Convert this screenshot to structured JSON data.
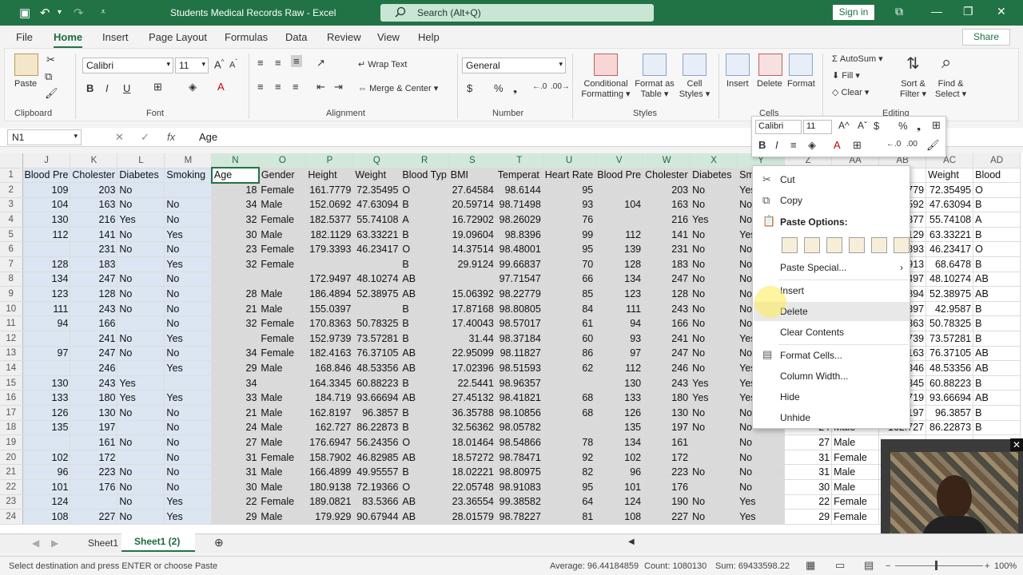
{
  "window": {
    "title": "Students Medical Records Raw  -  Excel",
    "search_placeholder": "Search (Alt+Q)",
    "signin": "Sign in"
  },
  "tabs": [
    "File",
    "Home",
    "Insert",
    "Page Layout",
    "Formulas",
    "Data",
    "Review",
    "View",
    "Help"
  ],
  "share": "Share",
  "ribbon": {
    "clipboard": {
      "label": "Clipboard",
      "paste": "Paste"
    },
    "font": {
      "label": "Font",
      "name": "Calibri",
      "size": "11"
    },
    "alignment": {
      "label": "Alignment",
      "wrap": "Wrap Text",
      "merge": "Merge & Center"
    },
    "number": {
      "label": "Number",
      "format": "General"
    },
    "styles": {
      "label": "Styles",
      "cond": "Conditional",
      "cond2": "Formatting",
      "fmt_table": "Format as",
      "fmt_table2": "Table",
      "cell_styles": "Cell",
      "cell_styles2": "Styles"
    },
    "cells": {
      "label": "Cells",
      "insert": "Insert",
      "delete": "Delete",
      "format": "Format"
    },
    "editing": {
      "label": "Editing",
      "autosum": "AutoSum",
      "fill": "Fill",
      "clear": "Clear",
      "sort": "Sort &",
      "sort2": "Filter",
      "find": "Find &",
      "find2": "Select"
    }
  },
  "formula_bar": {
    "name_box": "N1",
    "content": "Age"
  },
  "columns": [
    "J",
    "K",
    "L",
    "M",
    "N",
    "O",
    "P",
    "Q",
    "R",
    "S",
    "T",
    "U",
    "V",
    "W",
    "X",
    "Y",
    "Z",
    "AA",
    "AB",
    "AC",
    "AD"
  ],
  "rows": [
    [
      "1",
      "Blood Pre",
      "Cholester",
      "Diabetes",
      "Smoking",
      "Age",
      "Gender",
      "Height",
      "Weight",
      "Blood Typ",
      "BMI",
      "Temperat",
      "Heart Rate",
      "Blood Pre",
      "Cholester",
      "Diabetes",
      "Sm",
      "",
      "",
      "",
      "Weight",
      "Blood"
    ],
    [
      "2",
      "109",
      "203",
      "No",
      "",
      "18",
      "Female",
      "161.7779",
      "72.35495",
      "O",
      "27.64584",
      "98.6144",
      "95",
      "",
      "203",
      "No",
      "Yes",
      "",
      "",
      "779",
      "72.35495",
      "O"
    ],
    [
      "3",
      "104",
      "163",
      "No",
      "No",
      "34",
      "Male",
      "152.0692",
      "47.63094",
      "B",
      "20.59714",
      "98.71498",
      "93",
      "104",
      "163",
      "No",
      "No",
      "",
      "",
      "592",
      "47.63094",
      "B"
    ],
    [
      "4",
      "130",
      "216",
      "Yes",
      "No",
      "32",
      "Female",
      "182.5377",
      "55.74108",
      "A",
      "16.72902",
      "98.26029",
      "76",
      "",
      "216",
      "Yes",
      "No",
      "",
      "",
      "377",
      "55.74108",
      "A"
    ],
    [
      "5",
      "112",
      "141",
      "No",
      "Yes",
      "30",
      "Male",
      "182.1129",
      "63.33221",
      "B",
      "19.09604",
      "98.8396",
      "99",
      "112",
      "141",
      "No",
      "Yes",
      "",
      "",
      "129",
      "63.33221",
      "B"
    ],
    [
      "6",
      "",
      "231",
      "No",
      "No",
      "23",
      "Female",
      "179.3393",
      "46.23417",
      "O",
      "14.37514",
      "98.48001",
      "95",
      "139",
      "231",
      "No",
      "No",
      "",
      "",
      "393",
      "46.23417",
      "O"
    ],
    [
      "7",
      "128",
      "183",
      "",
      "Yes",
      "32",
      "Female",
      "",
      "",
      "B",
      "29.9124",
      "99.66837",
      "70",
      "128",
      "183",
      "No",
      "No",
      "",
      "",
      "913",
      "68.6478",
      "B"
    ],
    [
      "8",
      "134",
      "247",
      "No",
      "No",
      "",
      "",
      "172.9497",
      "48.10274",
      "AB",
      "",
      "97.71547",
      "66",
      "134",
      "247",
      "No",
      "No",
      "",
      "",
      "497",
      "48.10274",
      "AB"
    ],
    [
      "9",
      "123",
      "128",
      "No",
      "No",
      "28",
      "Male",
      "186.4894",
      "52.38975",
      "AB",
      "15.06392",
      "98.22779",
      "85",
      "123",
      "128",
      "No",
      "No",
      "",
      "",
      "894",
      "52.38975",
      "AB"
    ],
    [
      "10",
      "111",
      "243",
      "No",
      "No",
      "21",
      "Male",
      "155.0397",
      "",
      "B",
      "17.87168",
      "98.80805",
      "84",
      "111",
      "243",
      "No",
      "No",
      "",
      "",
      "397",
      "42.9587",
      "B"
    ],
    [
      "11",
      "94",
      "166",
      "",
      "No",
      "32",
      "Female",
      "170.8363",
      "50.78325",
      "B",
      "17.40043",
      "98.57017",
      "61",
      "94",
      "166",
      "No",
      "No",
      "",
      "",
      "363",
      "50.78325",
      "B"
    ],
    [
      "12",
      "",
      "241",
      "No",
      "Yes",
      "",
      "Female",
      "152.9739",
      "73.57281",
      "B",
      "31.44",
      "98.37184",
      "60",
      "93",
      "241",
      "No",
      "Yes",
      "",
      "",
      "739",
      "73.57281",
      "B"
    ],
    [
      "13",
      "97",
      "247",
      "No",
      "No",
      "34",
      "Female",
      "182.4163",
      "76.37105",
      "AB",
      "22.95099",
      "98.11827",
      "86",
      "97",
      "247",
      "No",
      "No",
      "",
      "",
      "163",
      "76.37105",
      "AB"
    ],
    [
      "14",
      "",
      "246",
      "",
      "Yes",
      "29",
      "Male",
      "168.846",
      "48.53356",
      "AB",
      "17.02396",
      "98.51593",
      "62",
      "112",
      "246",
      "No",
      "Yes",
      "",
      "",
      "346",
      "48.53356",
      "AB"
    ],
    [
      "15",
      "130",
      "243",
      "Yes",
      "",
      "34",
      "",
      "164.3345",
      "60.88223",
      "B",
      "22.5441",
      "98.96357",
      "",
      "130",
      "243",
      "Yes",
      "Yes",
      "",
      "",
      "345",
      "60.88223",
      "B"
    ],
    [
      "16",
      "133",
      "180",
      "Yes",
      "Yes",
      "33",
      "Male",
      "184.719",
      "93.66694",
      "AB",
      "27.45132",
      "98.41821",
      "68",
      "133",
      "180",
      "Yes",
      "Yes",
      "",
      "",
      "719",
      "93.66694",
      "AB"
    ],
    [
      "17",
      "126",
      "130",
      "No",
      "No",
      "21",
      "Male",
      "162.8197",
      "96.3857",
      "B",
      "36.35788",
      "98.10856",
      "68",
      "126",
      "130",
      "No",
      "No",
      "",
      "",
      "197",
      "96.3857",
      "B"
    ],
    [
      "18",
      "135",
      "197",
      "",
      "No",
      "24",
      "Male",
      "162.727",
      "86.22873",
      "B",
      "32.56362",
      "98.05782",
      "",
      "135",
      "197",
      "No",
      "No",
      "24",
      "Male",
      "162.727",
      "86.22873",
      "B"
    ],
    [
      "19",
      "",
      "161",
      "No",
      "No",
      "27",
      "Male",
      "176.6947",
      "56.24356",
      "O",
      "18.01464",
      "98.54866",
      "78",
      "134",
      "161",
      "",
      "No",
      "27",
      "Male",
      "",
      "",
      ""
    ],
    [
      "20",
      "102",
      "172",
      "",
      "No",
      "31",
      "Female",
      "158.7902",
      "46.82985",
      "AB",
      "18.57272",
      "98.78471",
      "92",
      "102",
      "172",
      "",
      "No",
      "31",
      "Female",
      "",
      "",
      ""
    ],
    [
      "21",
      "96",
      "223",
      "No",
      "No",
      "31",
      "Male",
      "166.4899",
      "49.95557",
      "B",
      "18.02221",
      "98.80975",
      "82",
      "96",
      "223",
      "No",
      "No",
      "31",
      "Male",
      "",
      "",
      ""
    ],
    [
      "22",
      "101",
      "176",
      "No",
      "No",
      "30",
      "Male",
      "180.9138",
      "72.19366",
      "O",
      "22.05748",
      "98.91083",
      "95",
      "101",
      "176",
      "",
      "No",
      "30",
      "Male",
      "",
      "",
      ""
    ],
    [
      "23",
      "124",
      "",
      "No",
      "Yes",
      "22",
      "Female",
      "189.0821",
      "83.5366",
      "AB",
      "23.36554",
      "99.38582",
      "64",
      "124",
      "190",
      "No",
      "Yes",
      "22",
      "Female",
      "",
      "",
      ""
    ],
    [
      "24",
      "108",
      "227",
      "No",
      "Yes",
      "29",
      "Male",
      "179.929",
      "90.67944",
      "AB",
      "28.01579",
      "98.78227",
      "81",
      "108",
      "227",
      "No",
      "Yes",
      "29",
      "Female",
      "",
      "",
      ""
    ]
  ],
  "context_menu": {
    "items": [
      "Cut",
      "Copy",
      "Paste Options:",
      "Paste Special...",
      "Insert",
      "Delete",
      "Clear Contents",
      "Format Cells...",
      "Column Width...",
      "Hide",
      "Unhide"
    ],
    "mini_font": "Calibri",
    "mini_size": "11"
  },
  "sheets": [
    "Sheet1",
    "Sheet1 (2)"
  ],
  "status": {
    "message": "Select destination and press ENTER or choose Paste",
    "average": "Average: 96.44184859",
    "count": "Count: 1080130",
    "sum": "Sum: 69433598.22",
    "zoom": "100%"
  },
  "colors": {
    "accent": "#217346",
    "selection": "#dadada"
  }
}
